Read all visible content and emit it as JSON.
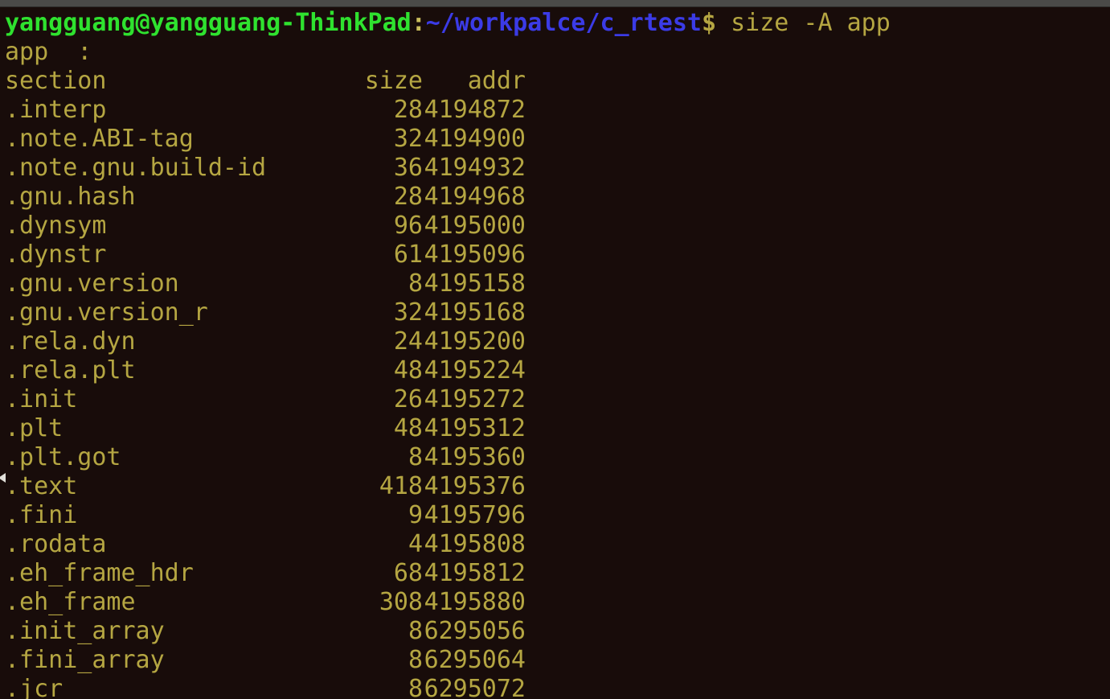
{
  "terminal": {
    "background_color": "#180c0a",
    "foreground_color": "#b5a642",
    "prompt_user_color": "#2fe22f",
    "prompt_path_color": "#3b3be6",
    "chrome_color": "#4a4a48"
  },
  "prompt": {
    "user_host": "yangguang@yangguang-ThinkPad",
    "separator": ":",
    "path": "~/workpalce/c_rtest",
    "sigil": "$",
    "command": " size -A app"
  },
  "output": {
    "file_header": "app  :",
    "columns": {
      "section": "section",
      "size": "size",
      "addr": "addr"
    },
    "rows": [
      {
        "section": ".interp",
        "size": "28",
        "addr": "4194872"
      },
      {
        "section": ".note.ABI-tag",
        "size": "32",
        "addr": "4194900"
      },
      {
        "section": ".note.gnu.build-id",
        "size": "36",
        "addr": "4194932"
      },
      {
        "section": ".gnu.hash",
        "size": "28",
        "addr": "4194968"
      },
      {
        "section": ".dynsym",
        "size": "96",
        "addr": "4195000"
      },
      {
        "section": ".dynstr",
        "size": "61",
        "addr": "4195096"
      },
      {
        "section": ".gnu.version",
        "size": "8",
        "addr": "4195158"
      },
      {
        "section": ".gnu.version_r",
        "size": "32",
        "addr": "4195168"
      },
      {
        "section": ".rela.dyn",
        "size": "24",
        "addr": "4195200"
      },
      {
        "section": ".rela.plt",
        "size": "48",
        "addr": "4195224"
      },
      {
        "section": ".init",
        "size": "26",
        "addr": "4195272"
      },
      {
        "section": ".plt",
        "size": "48",
        "addr": "4195312"
      },
      {
        "section": ".plt.got",
        "size": "8",
        "addr": "4195360"
      },
      {
        "section": ".text",
        "size": "418",
        "addr": "4195376"
      },
      {
        "section": ".fini",
        "size": "9",
        "addr": "4195796"
      },
      {
        "section": ".rodata",
        "size": "4",
        "addr": "4195808"
      },
      {
        "section": ".eh_frame_hdr",
        "size": "68",
        "addr": "4195812"
      },
      {
        "section": ".eh_frame",
        "size": "308",
        "addr": "4195880"
      },
      {
        "section": ".init_array",
        "size": "8",
        "addr": "6295056"
      },
      {
        "section": ".fini_array",
        "size": "8",
        "addr": "6295064"
      },
      {
        "section": ".jcr",
        "size": "8",
        "addr": "6295072"
      }
    ]
  }
}
